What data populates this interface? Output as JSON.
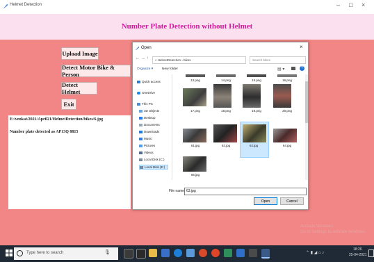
{
  "window": {
    "title": "Helmet Detection",
    "minimize": "–",
    "maximize": "□",
    "close": "×"
  },
  "header": {
    "title": "Number Plate Detection without Helmet"
  },
  "buttons": {
    "upload": "Upload Image",
    "detect_bike_person": "Detect Motor Bike & Person",
    "detect_helmet": "Detect Helmet",
    "exit": "Exit"
  },
  "output": {
    "path": "E:/venkat/2021/April21/HelmetDetection/bikes/6.jpg",
    "result": "Number plate detected as AP13Q 8815"
  },
  "dialog": {
    "title": "Open",
    "close": "×",
    "address": "« HelmetDetection › bikes",
    "search_placeholder": "Search bikes",
    "organize": "Organize ▾",
    "new_folder": "New folder",
    "nav_items": [
      "Quick access",
      "OneDrive",
      "This PC",
      "3D Objects",
      "Desktop",
      "Documents",
      "Downloads",
      "Music",
      "Pictures",
      "Videos",
      "Local Disk (C:)",
      "Local Disk (E:)"
    ],
    "files_row1": [
      "13.png",
      "14.png",
      "15.png",
      "16.png"
    ],
    "files_row2": [
      "17.png",
      "18.png",
      "19.png",
      "20.png"
    ],
    "files_row3": [
      "61.jpg",
      "62.jpg",
      "63.jpg",
      "64.jpg"
    ],
    "files_row4": [
      "65.jpg"
    ],
    "selected_file": "63.jpg",
    "filename_label": "File name:",
    "filename_value": "63.jpg",
    "open_btn": "Open",
    "cancel_btn": "Cancel"
  },
  "taskbar": {
    "search_placeholder": "Type here to search",
    "time": "18:26",
    "date": "25-04-2021"
  },
  "watermark": {
    "line1": "Activate Windows",
    "line2": "Go to Settings to activate Windows."
  },
  "colors": {
    "app_bg": "#f28585",
    "header_bg": "#fbe0f0",
    "title_color": "#d11b9d",
    "taskbar": "#1f2a36"
  }
}
